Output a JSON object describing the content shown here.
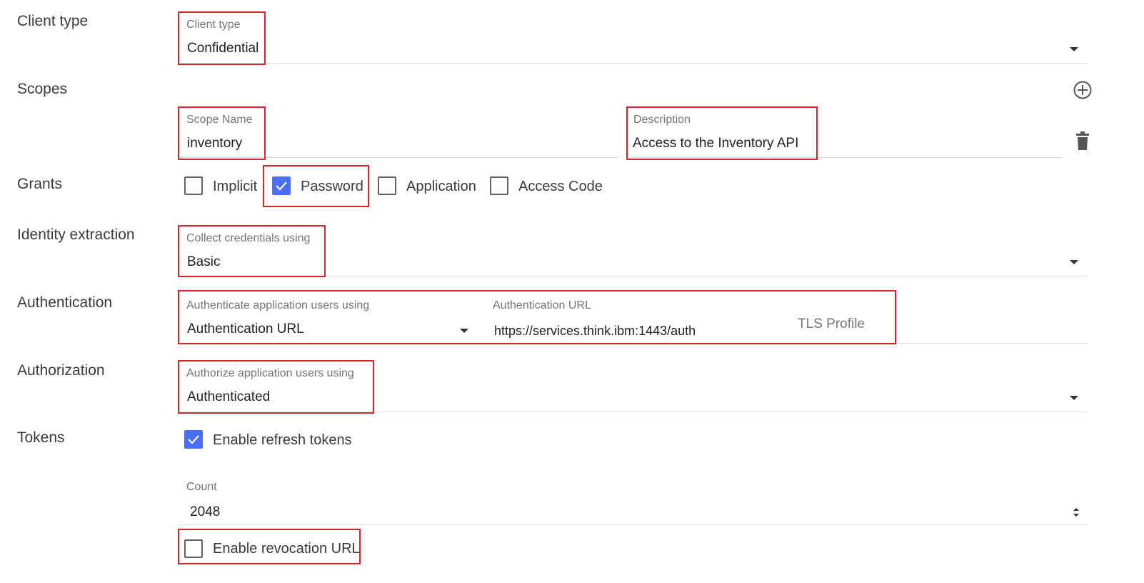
{
  "rows": {
    "client_type": "Client type",
    "scopes": "Scopes",
    "grants": "Grants",
    "identity_extraction": "Identity extraction",
    "authentication": "Authentication",
    "authorization": "Authorization",
    "tokens": "Tokens"
  },
  "client_type": {
    "label": "Client type",
    "value": "Confidential"
  },
  "scope": {
    "name_label": "Scope Name",
    "name_value": "inventory",
    "description_label": "Description",
    "description_value": "Access to the Inventory API"
  },
  "grants": [
    {
      "label": "Implicit",
      "checked": false
    },
    {
      "label": "Password",
      "checked": true
    },
    {
      "label": "Application",
      "checked": false
    },
    {
      "label": "Access Code",
      "checked": false
    }
  ],
  "identity": {
    "label": "Collect credentials using",
    "value": "Basic"
  },
  "authentication": {
    "method_label": "Authenticate application users using",
    "method_value": "Authentication URL",
    "url_label": "Authentication URL",
    "url_value": "https://services.think.ibm:1443/auth",
    "tls_label": "TLS Profile"
  },
  "authorization": {
    "label": "Authorize application users using",
    "value": "Authenticated"
  },
  "tokens": {
    "refresh_label": "Enable refresh tokens",
    "refresh_checked": true,
    "count_label": "Count",
    "count_value": "2048",
    "revocation_label": "Enable revocation URL",
    "revocation_checked": false
  },
  "colors": {
    "accent": "#4a6ef5",
    "highlight": "#d9262e",
    "divider": "#dcdcdc"
  }
}
